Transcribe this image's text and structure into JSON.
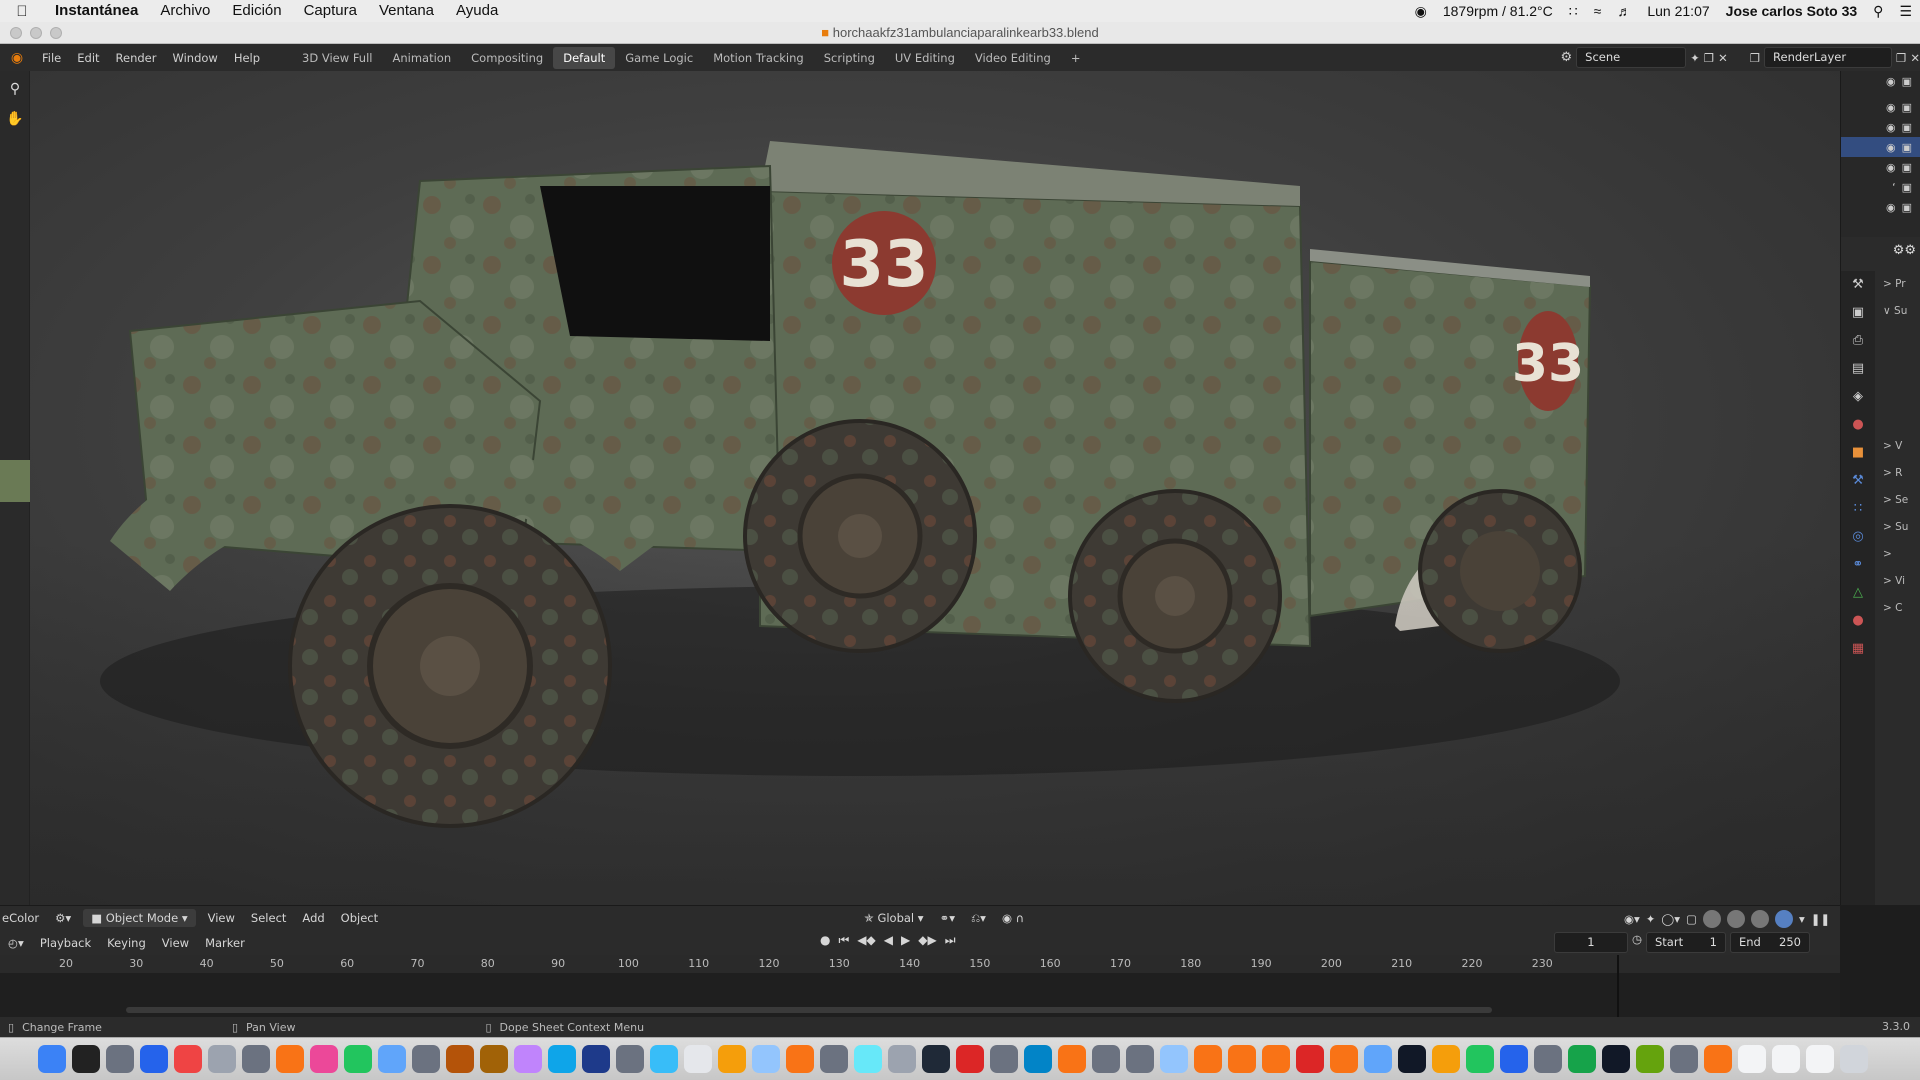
{
  "macmenu": {
    "apple": "",
    "items": [
      "Instantánea",
      "Archivo",
      "Edición",
      "Captura",
      "Ventana",
      "Ayuda"
    ],
    "status_fan": "1879rpm / 81.2°C",
    "clock": "Lun 21:07",
    "user": "Jose carlos Soto 33"
  },
  "window": {
    "title": "horchaakfz31ambulanciaparalinkearb33.blend"
  },
  "topbar": {
    "menus": [
      "File",
      "Edit",
      "Render",
      "Window",
      "Help"
    ],
    "workspaces": [
      "3D View Full",
      "Animation",
      "Compositing",
      "Default",
      "Game Logic",
      "Motion Tracking",
      "Scripting",
      "UV Editing",
      "Video Editing"
    ],
    "active_workspace": "Default",
    "add": "+",
    "scene": "Scene",
    "render_layer": "RenderLayer"
  },
  "viewport": {
    "vehicle_number": "33",
    "trailer_number": "33",
    "palette": {
      "body": "#5e6b55",
      "mud": "#6e4a38",
      "tire": "#3e3a34",
      "emblem": "#8c3a30"
    }
  },
  "view_header": {
    "left_cut": "eColor",
    "mode": "Object Mode",
    "menus": [
      "View",
      "Select",
      "Add",
      "Object"
    ],
    "orientation": "Global"
  },
  "timeline_header": {
    "menus": [
      "Playback",
      "Keying",
      "View",
      "Marker"
    ],
    "current_frame": "1",
    "start_label": "Start",
    "start": "1",
    "end_label": "End",
    "end": "250"
  },
  "timeline": {
    "ticks": [
      "20",
      "30",
      "40",
      "50",
      "60",
      "70",
      "80",
      "90",
      "100",
      "110",
      "120",
      "130",
      "140",
      "150",
      "160",
      "170",
      "180",
      "190",
      "200",
      "210",
      "220",
      "230"
    ]
  },
  "props_side": [
    ">  Pr",
    "∨  Su",
    "",
    "",
    "",
    "",
    ">  V",
    ">  R",
    ">  Se",
    ">  Su",
    ">",
    "> Vi",
    ">  C"
  ],
  "statusbar": {
    "change_frame": "Change Frame",
    "pan_view": "Pan View",
    "context": "Dope Sheet Context Menu",
    "version": "3.3.0"
  }
}
